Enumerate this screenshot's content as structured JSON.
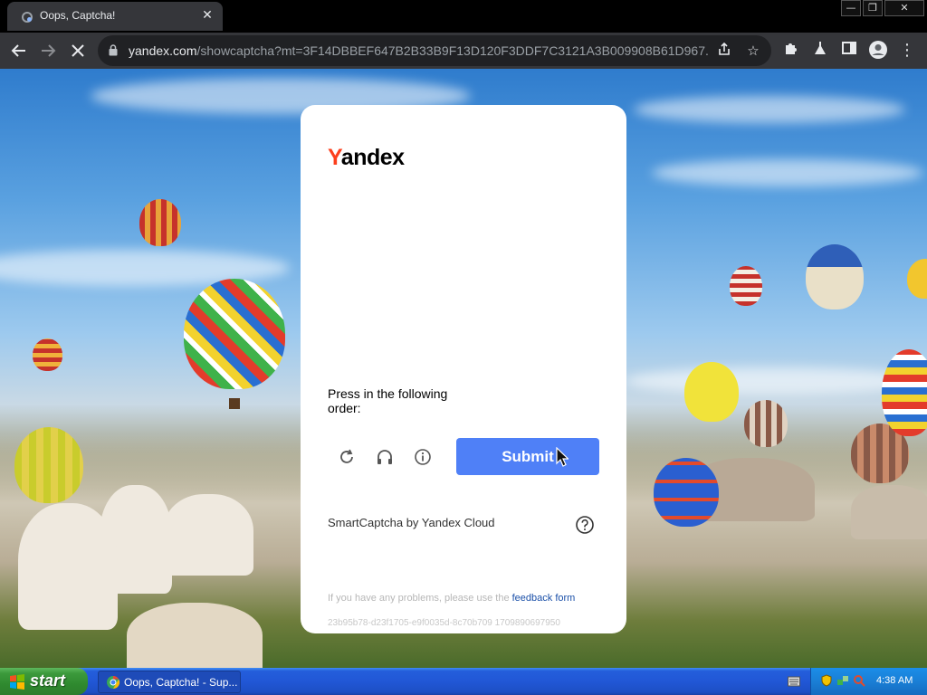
{
  "browser": {
    "tab_title": "Oops, Captcha!",
    "url_main": "yandex.com",
    "url_rest": "/showcaptcha?mt=3F14DBBEF647B2B33B9F13D120F3DDF7C3121A3B009908B61D967..."
  },
  "captcha": {
    "logo_first": "Y",
    "logo_rest": "andex",
    "instruction": "Press in the following order:",
    "submit_label": "Submit",
    "branding": "SmartCaptcha by Yandex Cloud",
    "problems_text": "If you have any problems, please use the ",
    "feedback_link": "feedback form",
    "hash": "23b95b78-d23f1705-e9f0035d-8c70b709 1709890697950",
    "brand_color": "#fc3f1d",
    "button_color": "#4f80f7"
  },
  "taskbar": {
    "start_label": "start",
    "task_label": "Oops, Captcha! - Sup...",
    "clock": "4:38 AM"
  }
}
